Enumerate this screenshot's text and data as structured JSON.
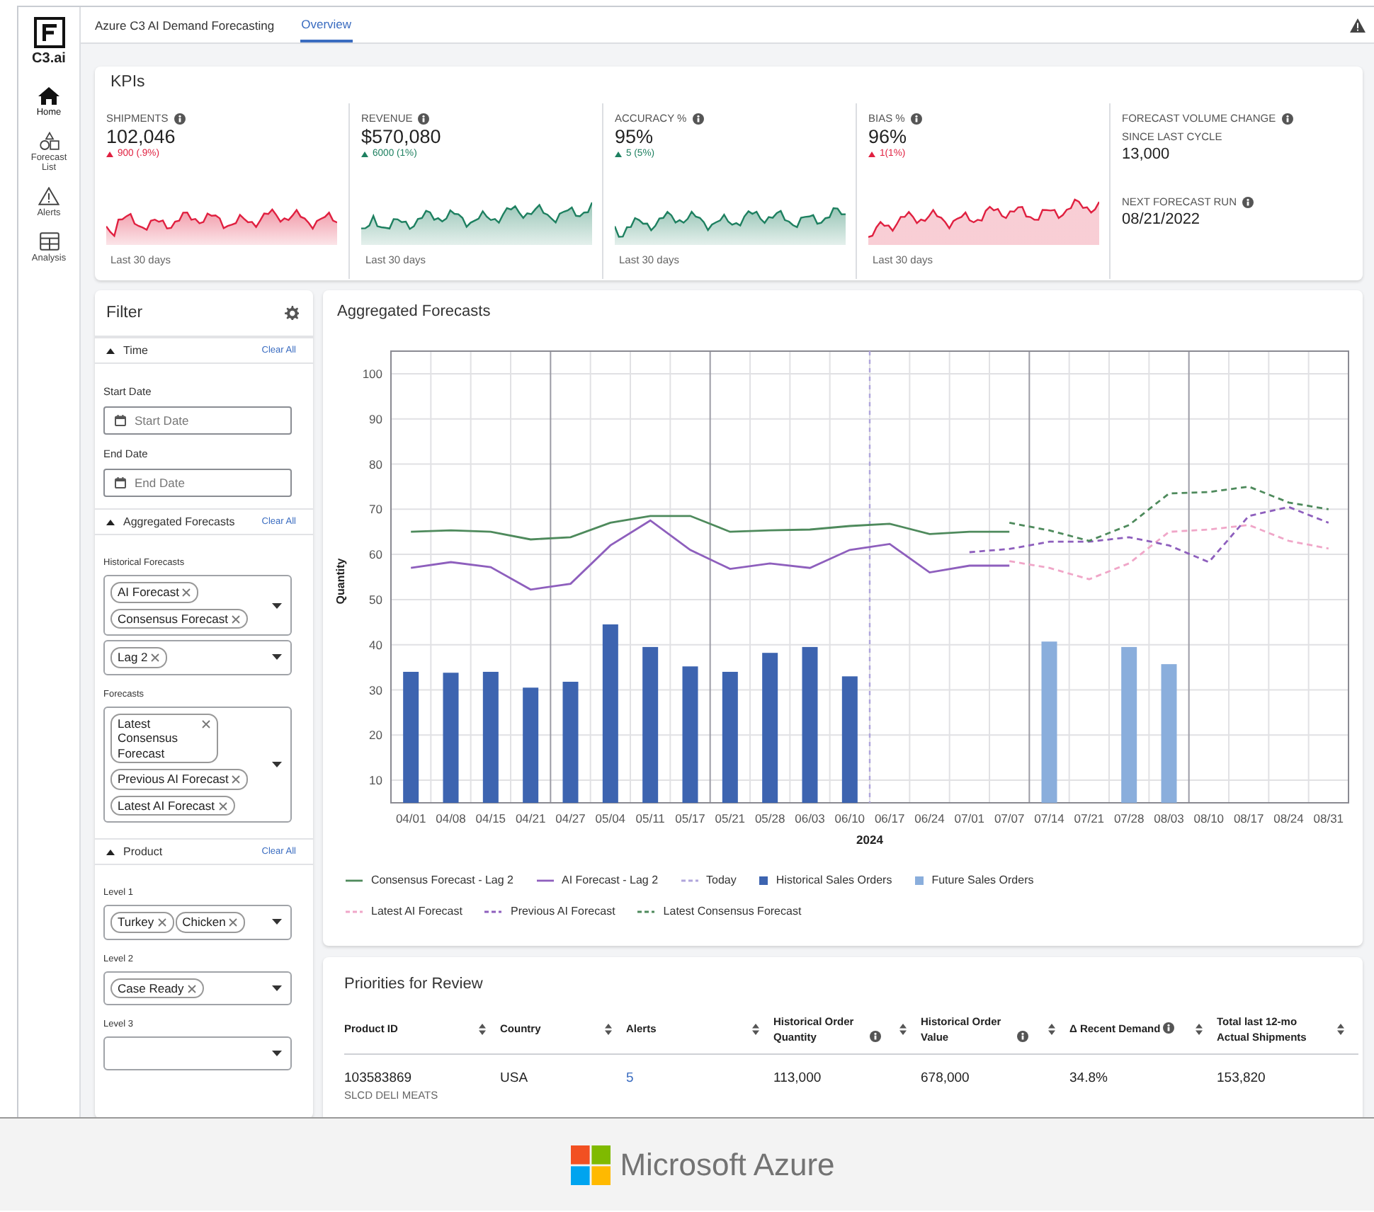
{
  "nav": {
    "logo_text": "C3.ai",
    "items": [
      {
        "label": "Home",
        "kind": "home",
        "selected": true
      },
      {
        "label": "Forecast List",
        "kind": "shapes",
        "selected": false
      },
      {
        "label": "Alerts",
        "kind": "alert",
        "selected": false
      },
      {
        "label": "Analysis",
        "kind": "table",
        "selected": false
      }
    ]
  },
  "top_bar": {
    "app_title": "Azure C3 AI Demand Forecasting",
    "tabs": [
      {
        "label": "Overview",
        "selected": true
      }
    ]
  },
  "kpis": {
    "title": "KPIs",
    "metrics": [
      {
        "label": "SHIPMENTS",
        "value": "102,046",
        "delta": "900 (.9%)",
        "color": "#e02040",
        "period": "Last 30 days"
      },
      {
        "label": "REVENUE",
        "value": "$570,080",
        "delta": "6000 (1%)",
        "color": "#1e8060",
        "period": "Last 30 days"
      },
      {
        "label": "ACCURACY %",
        "value": "95%",
        "delta": "5 (5%)",
        "color": "#1e8060",
        "period": "Last 30 days"
      },
      {
        "label": "BIAS %",
        "value": "96%",
        "delta": "1(1%)",
        "color": "#e02040",
        "period": "Last 30 days"
      }
    ],
    "summary": {
      "label": "FORECAST VOLUME CHANGE",
      "sublabel": "SINCE LAST CYCLE",
      "value": "13,000",
      "next_label": "NEXT FORECAST RUN",
      "next_value": "08/21/2022"
    }
  },
  "filter": {
    "title": "Filter",
    "sections": [
      {
        "title": "Time",
        "expanded": true,
        "clear_label": "Clear All",
        "fields": [
          {
            "kind": "date",
            "label": "Start Date",
            "placeholder": "Start Date"
          },
          {
            "kind": "date",
            "label": "End Date",
            "placeholder": "End Date"
          }
        ]
      },
      {
        "title": "Aggregated Forecasts",
        "expanded": true,
        "clear_label": "Clear All",
        "fields": [
          {
            "kind": "multi",
            "label": "Historical Forecasts",
            "chips": [
              "AI Forecast",
              "Consensus Forecast"
            ]
          },
          {
            "kind": "multi",
            "chips": [
              "Lag 2"
            ]
          },
          {
            "kind": "multi",
            "label": "Forecasts",
            "chips": [
              "Latest Consensus Forecast",
              "Previous AI Forecast",
              "Latest AI Forecast"
            ]
          }
        ]
      },
      {
        "title": "Product",
        "expanded": true,
        "clear_label": "Clear All",
        "fields": [
          {
            "kind": "multi",
            "label": "Level 1",
            "chips": [
              "Turkey",
              "Chicken"
            ]
          },
          {
            "kind": "multi",
            "label": "Level 2",
            "chips": [
              "Case Ready"
            ]
          },
          {
            "kind": "multi",
            "label": "Level 3"
          }
        ]
      }
    ]
  },
  "forecast": {
    "title": "Aggregated Forecasts",
    "chart_data": {
      "type": "bar",
      "xlabel": "2024",
      "ylabel": "Quantity",
      "grid": true,
      "categories": [
        "04/01",
        "04/08",
        "04/15",
        "04/21",
        "04/27",
        "05/04",
        "05/11",
        "05/17",
        "05/21",
        "05/28",
        "06/03",
        "06/10",
        "06/17",
        "06/24",
        "07/01",
        "07/07",
        "07/14",
        "07/21",
        "07/28",
        "08/03",
        "08/10",
        "08/17",
        "08/24",
        "08/31"
      ],
      "ylim": [
        5,
        105
      ],
      "yticks": [
        10,
        20,
        30,
        40,
        50,
        60,
        70,
        80,
        90,
        100
      ],
      "series": [
        {
          "name": "Consensus Forecast - Lag 2",
          "type": "line",
          "line_style": "solid",
          "color": "#4e8a5c",
          "values": [
            65,
            65.3,
            65,
            63.3,
            63.8,
            67,
            68.5,
            68.5,
            65,
            65.3,
            65.5,
            66.3,
            66.8,
            64.5,
            65,
            65,
            null,
            null,
            null,
            null,
            null,
            null,
            null,
            null
          ]
        },
        {
          "name": "AI Forecast - Lag 2",
          "type": "line",
          "line_style": "solid",
          "color": "#8e5fbd",
          "values": [
            57,
            58.3,
            57.2,
            52.2,
            53.5,
            62,
            67.5,
            61,
            56.8,
            58,
            57,
            61,
            62.3,
            56,
            57.5,
            57.5,
            null,
            null,
            null,
            null,
            null,
            null,
            null,
            null
          ]
        },
        {
          "name": "Historical Sales Orders",
          "type": "bar",
          "color": "#3d64b0",
          "values": [
            34,
            33.8,
            34,
            30.5,
            31.8,
            44.5,
            39.5,
            35.2,
            34,
            38.2,
            39.5,
            33,
            null,
            null,
            null,
            null,
            null,
            null,
            null,
            null,
            null,
            null,
            null,
            null
          ]
        },
        {
          "name": "Future Sales Orders",
          "type": "bar",
          "color": "#8aaedc",
          "values": [
            null,
            null,
            null,
            null,
            null,
            null,
            null,
            null,
            null,
            null,
            null,
            null,
            null,
            null,
            null,
            null,
            40.7,
            null,
            39.5,
            35.7,
            null,
            null,
            null,
            null
          ]
        },
        {
          "name": "Latest AI Forecast",
          "type": "line",
          "line_style": "dashed",
          "color": "#f0a6c8",
          "values": [
            null,
            null,
            null,
            null,
            null,
            null,
            null,
            null,
            null,
            null,
            null,
            null,
            null,
            null,
            null,
            58.5,
            57,
            54.5,
            58,
            65,
            65.5,
            66.5,
            63,
            61.3
          ]
        },
        {
          "name": "Previous AI Forecast",
          "type": "line",
          "line_style": "dashed",
          "color": "#8e5fbd",
          "values": [
            null,
            null,
            null,
            null,
            null,
            null,
            null,
            null,
            null,
            null,
            null,
            null,
            null,
            null,
            60.5,
            61.2,
            62.8,
            62.8,
            63.8,
            62,
            58.3,
            68.5,
            70.5,
            67
          ]
        },
        {
          "name": "Latest Consensus Forecast",
          "type": "line",
          "line_style": "dashed",
          "color": "#4e8a5c",
          "values": [
            null,
            null,
            null,
            null,
            null,
            null,
            null,
            null,
            null,
            null,
            null,
            null,
            null,
            null,
            null,
            67,
            65.3,
            63,
            66.5,
            73.5,
            73.8,
            75,
            71.5,
            70
          ]
        }
      ],
      "ref_lines": [
        {
          "axis": "x",
          "value": "06/17",
          "label": "Today",
          "color": "#b0a6dc",
          "line_style": "dashed"
        }
      ]
    }
  },
  "priorities": {
    "title": "Priorities for Review",
    "columns": [
      {
        "label": "Product ID",
        "info": false
      },
      {
        "label": "Country",
        "info": false
      },
      {
        "label": "Alerts",
        "info": false
      },
      {
        "label": "Historical Order Quantity",
        "info": true
      },
      {
        "label": "Historical Order Value",
        "info": true
      },
      {
        "label": "Δ Recent Demand",
        "info": true
      },
      {
        "label": "Total last 12-mo Actual Shipments",
        "info": false
      }
    ],
    "rows": [
      {
        "product_id": "103583869",
        "description": "SLCD DELI MEATS",
        "country": "USA",
        "alerts": "5",
        "historical_order_quantity": "113,000",
        "historical_order_value": "678,000",
        "recent_demand_change": "34.8%",
        "total_shipments": "153,820"
      }
    ]
  },
  "banner": {
    "text": "Microsoft Azure"
  }
}
